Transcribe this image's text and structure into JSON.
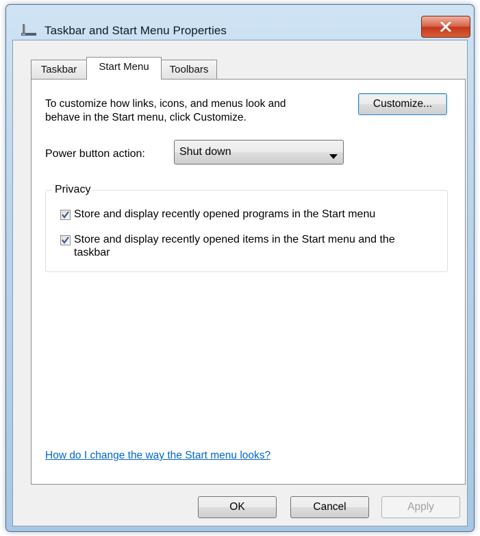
{
  "window": {
    "title": "Taskbar and Start Menu Properties",
    "close_label": "x"
  },
  "tabs": [
    {
      "label": "Taskbar",
      "active": false
    },
    {
      "label": "Start Menu",
      "active": true
    },
    {
      "label": "Toolbars",
      "active": false
    }
  ],
  "start_menu": {
    "description_line1": "To customize how links, icons, and menus look and",
    "description_line2": "behave in the Start menu, click Customize.",
    "customize_label": "Customize...",
    "power_label": "Power button action:",
    "power_value": "Shut down",
    "privacy": {
      "title": "Privacy",
      "store_programs": {
        "label": "Store and display recently opened programs in the Start menu",
        "checked": true
      },
      "store_items": {
        "line1": "Store and display recently opened items in the Start menu and the",
        "line2": "taskbar",
        "checked": true
      }
    },
    "help_link": "How do I change the way the Start menu looks?"
  },
  "footer": {
    "ok_label": "OK",
    "cancel_label": "Cancel",
    "apply_label": "Apply"
  },
  "colors": {
    "link": "#0066cc",
    "checkmark": "#3d5a8a",
    "close_button": "#c4371c"
  }
}
